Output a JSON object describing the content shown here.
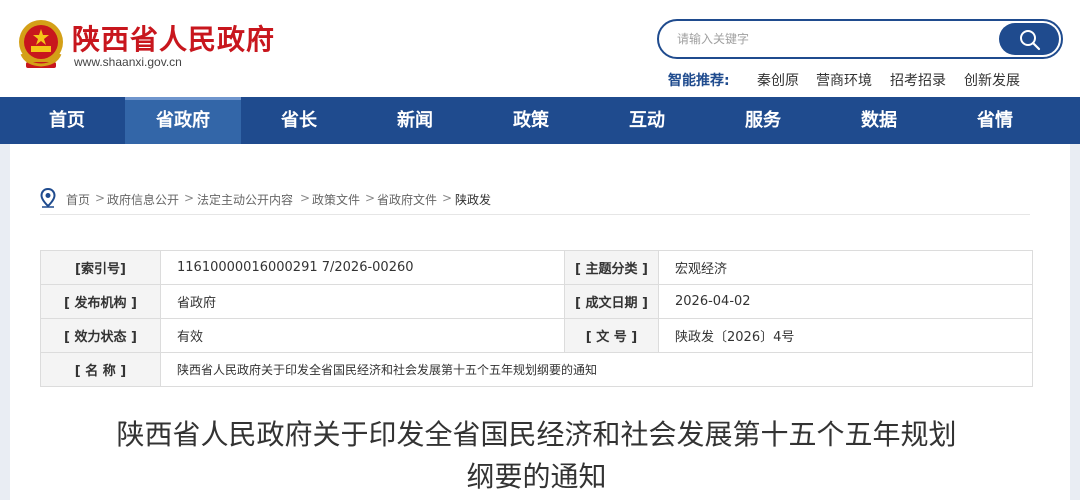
{
  "header": {
    "site_name": "陕西省人民政府",
    "site_url": "www.shaanxi.gov.cn",
    "search": {
      "placeholder": "请输入关键字"
    },
    "recommend": {
      "label": "智能推荐:",
      "items": [
        "秦创原",
        "营商环境",
        "招考招录",
        "创新发展"
      ]
    }
  },
  "nav": {
    "items": [
      "首页",
      "省政府",
      "省长",
      "新闻",
      "政策",
      "互动",
      "服务",
      "数据",
      "省情"
    ],
    "active": "省政府"
  },
  "breadcrumb": {
    "items": [
      "首页",
      "政府信息公开",
      "法定主动公开内容",
      "政策文件",
      "省政府文件",
      "陕政发"
    ],
    "separator": ">"
  },
  "meta": {
    "index_label": "[索引号]",
    "index_value": "11610000016000291 7/2026-00260",
    "topic_label": "[ 主题分类 ]",
    "topic_value": "宏观经济",
    "publisher_label": "[ 发布机构 ]",
    "publisher_value": "省政府",
    "date_label": "[ 成文日期 ]",
    "date_value": "2026-04-02",
    "status_label": "[ 效力状态 ]",
    "status_value": "有效",
    "docno_label": "[ 文 号 ]",
    "docno_value": "陕政发〔2026〕4号",
    "name_label": "[ 名 称 ]",
    "name_value": "陕西省人民政府关于印发全省国民经济和社会发展第十五个五年规划纲要的通知"
  },
  "document": {
    "title_line1": "陕西省人民政府关于印发全省国民经济和社会发展第十五个五年规划",
    "title_line2": "纲要的通知"
  },
  "colors": {
    "brand_red": "#c8161d",
    "nav_blue": "#1f4b8e",
    "nav_active": "#3366a8"
  }
}
